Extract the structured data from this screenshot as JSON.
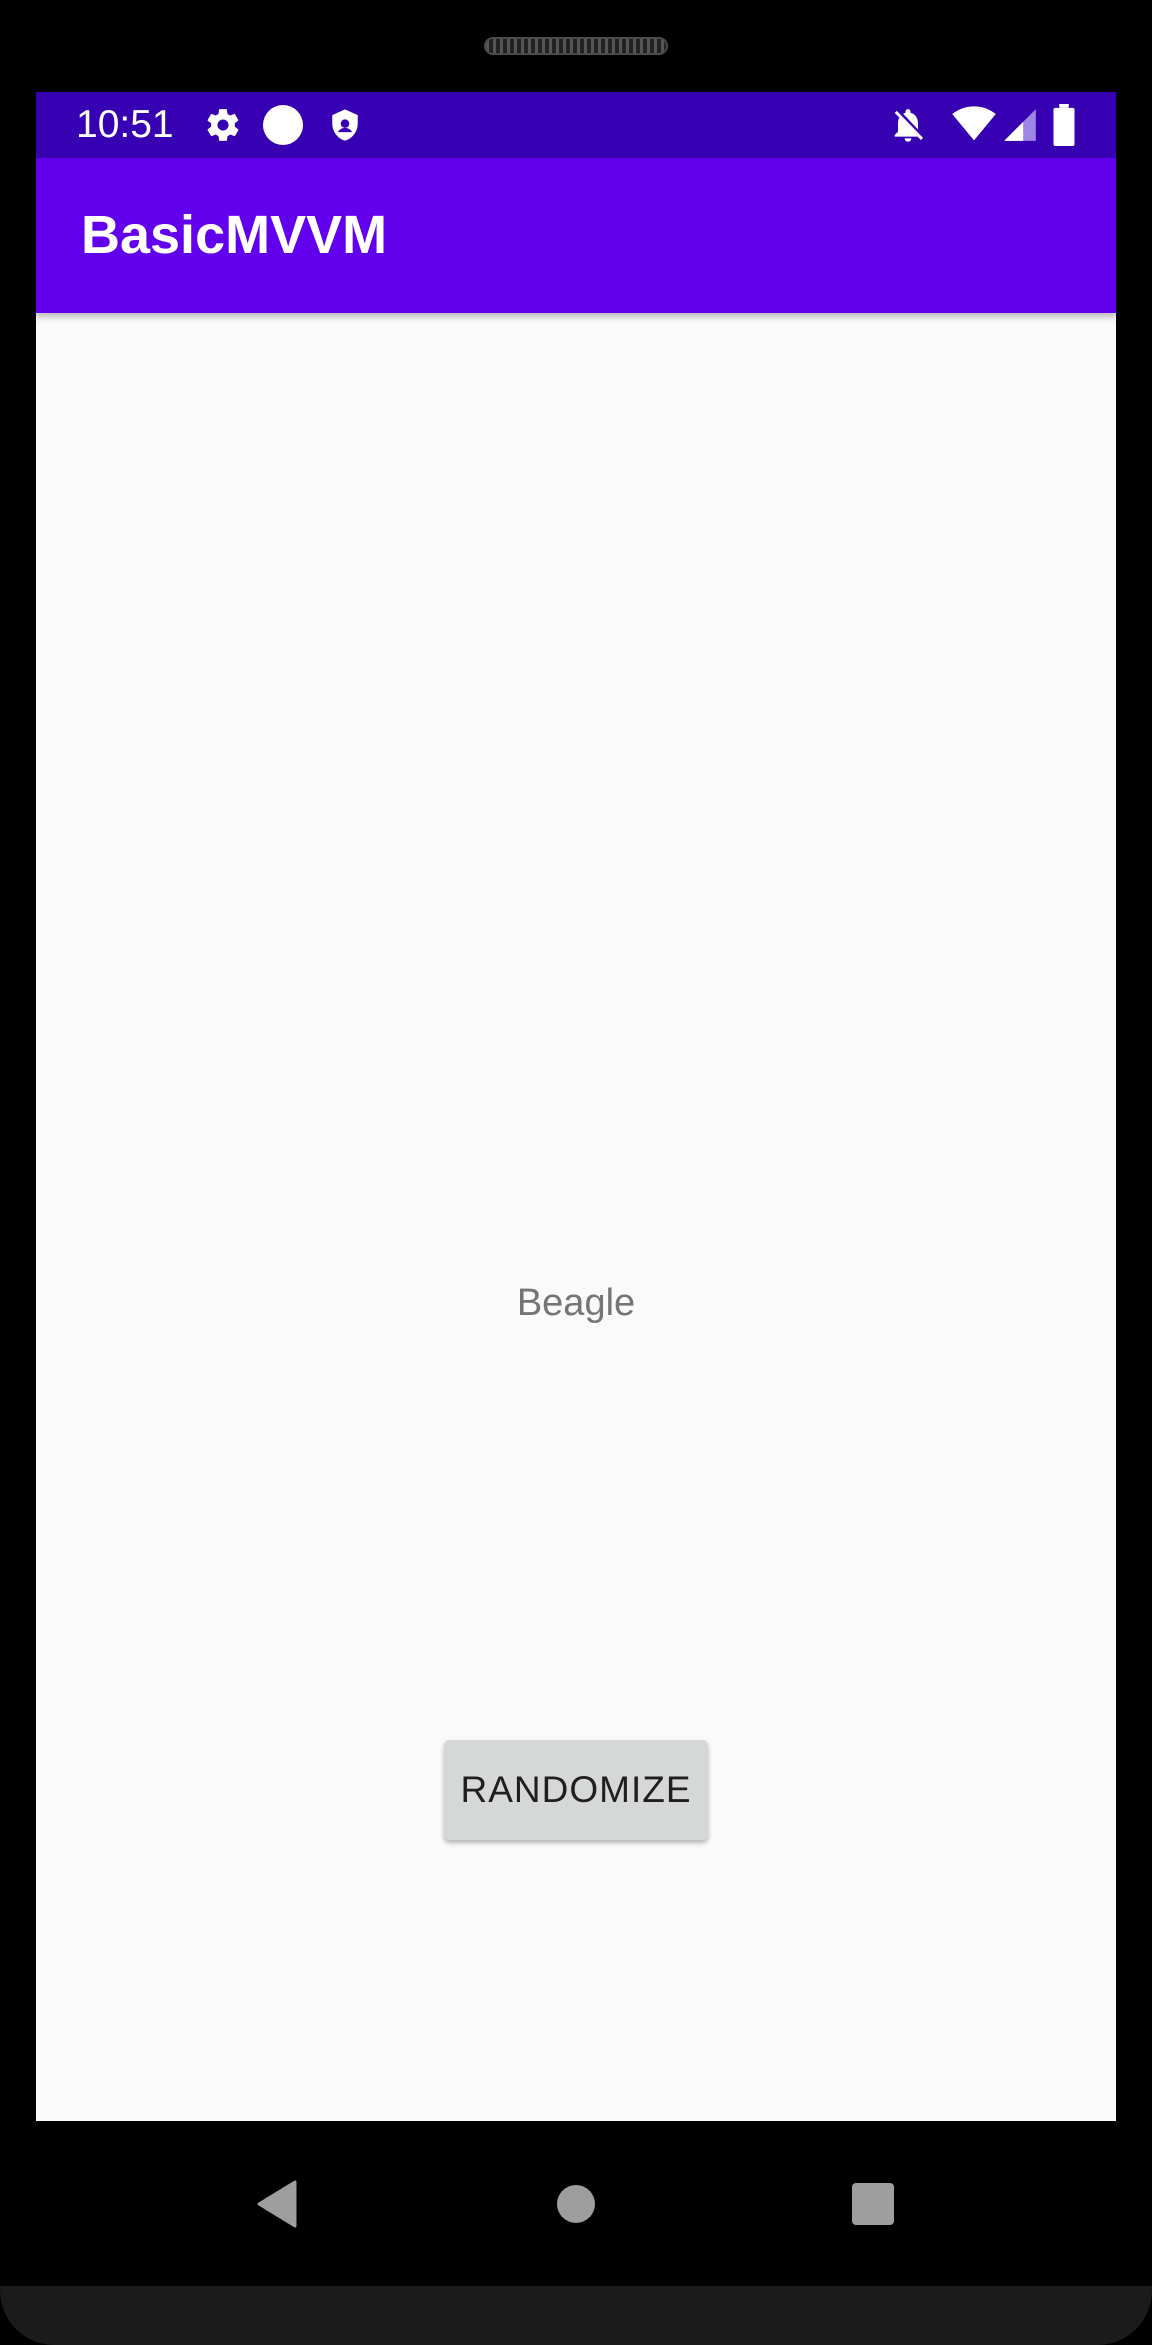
{
  "status_bar": {
    "time": "10:51",
    "icons": [
      "settings-gear-icon",
      "circle-dot-icon",
      "shield-icon",
      "notifications-off-icon",
      "wifi-icon",
      "cellular-signal-icon",
      "battery-icon"
    ]
  },
  "app_bar": {
    "title": "BasicMVVM"
  },
  "main": {
    "breed_text": "Beagle",
    "randomize_label": "RANDOMIZE"
  },
  "navigation_bar": {
    "buttons": [
      "back-icon",
      "home-icon",
      "recents-icon"
    ]
  },
  "colors": {
    "status_bar": "#3700b3",
    "app_bar": "#6200ee",
    "background": "#fafafa",
    "button": "#d6d7d7",
    "breed_text": "#757575"
  }
}
